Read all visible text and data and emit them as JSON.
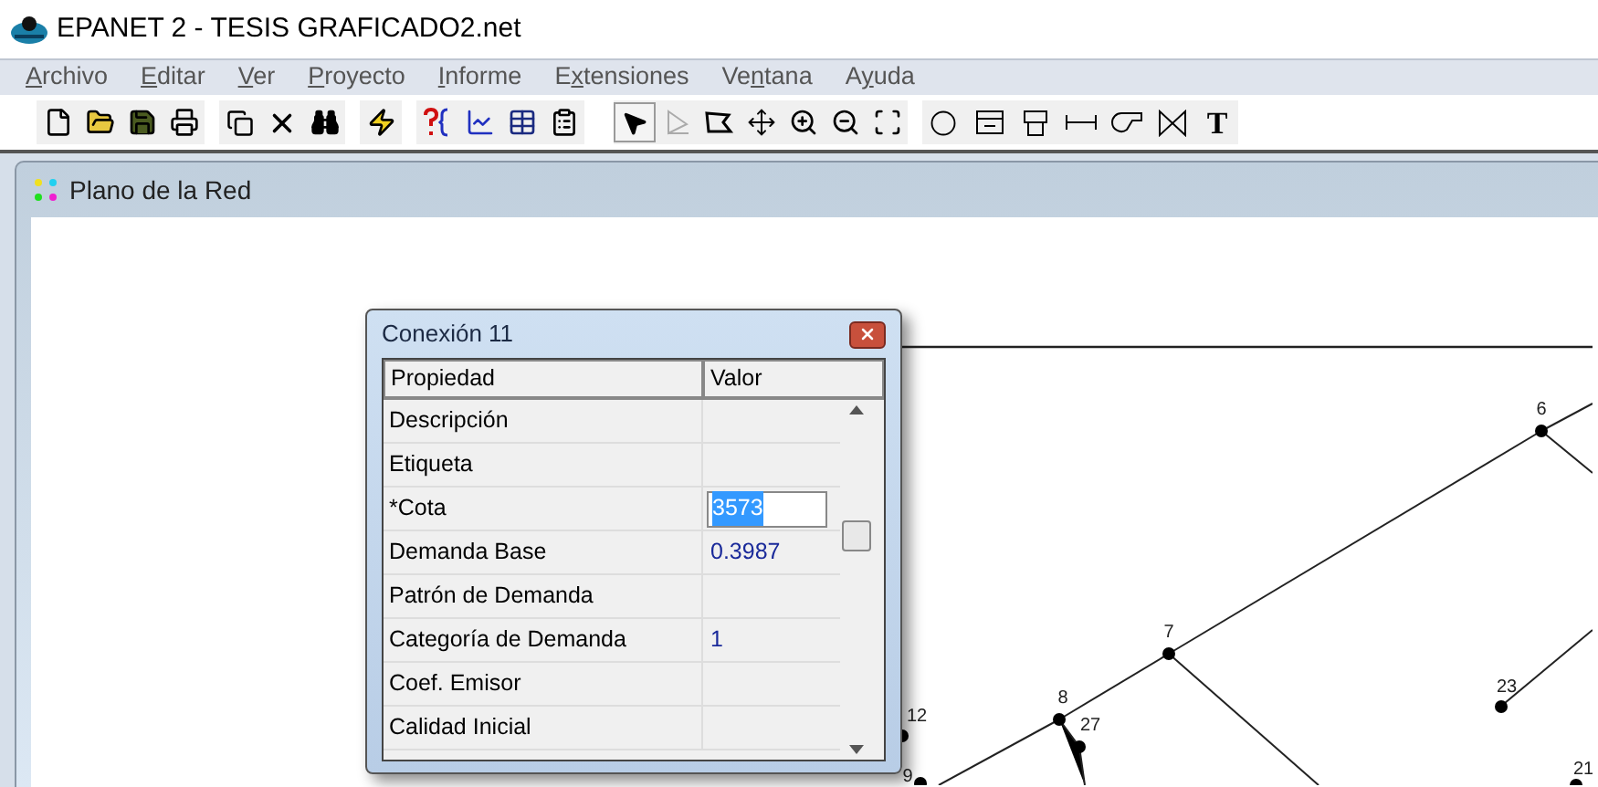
{
  "window": {
    "title": "EPANET 2 - TESIS GRAFICADO2.net"
  },
  "menu": [
    {
      "key": "A",
      "after": "rchivo"
    },
    {
      "key": "E",
      "after": "ditar"
    },
    {
      "key": "V",
      "after": "er"
    },
    {
      "key": "P",
      "after": "royecto"
    },
    {
      "key": "I",
      "after": "nforme"
    },
    {
      "before": "E",
      "key": "x",
      "after": "tensiones"
    },
    {
      "before": "Ve",
      "key": "n",
      "after": "tana"
    },
    {
      "before": "A",
      "key": "y",
      "after": "uda"
    }
  ],
  "map_tools": [
    {
      "kind": "select",
      "selected": true
    },
    {
      "kind": "vertex",
      "selected": false,
      "disabled": true
    },
    {
      "kind": "region",
      "selected": false
    },
    {
      "kind": "pan",
      "selected": false
    },
    {
      "kind": "zoomin",
      "selected": false
    },
    {
      "kind": "zoomout",
      "selected": false
    },
    {
      "kind": "extent",
      "selected": false
    },
    {
      "kind": "junction",
      "selected": false
    },
    {
      "kind": "reservoir",
      "selected": false
    },
    {
      "kind": "tank",
      "selected": false
    },
    {
      "kind": "pipe",
      "selected": false
    },
    {
      "kind": "pump",
      "selected": false
    },
    {
      "kind": "valve",
      "selected": false
    },
    {
      "kind": "label",
      "text": "T",
      "selected": false
    }
  ],
  "map_window": {
    "title": "Plano de la Red"
  },
  "map": {
    "nodes": [
      "6",
      "7",
      "8",
      "27",
      "23",
      "21",
      "12",
      "9"
    ]
  },
  "dialog": {
    "title": "Conexión 11",
    "columns": [
      "Propiedad",
      "Valor"
    ],
    "rows": [
      {
        "property": "Descripción"
      },
      {
        "property": "Etiqueta"
      },
      {
        "property": "*Cota",
        "value": "3573",
        "editing": true
      },
      {
        "property": "Demanda Base",
        "value": "0.3987",
        "editing": false
      },
      {
        "property": "Patrón de Demanda"
      },
      {
        "property": "Categoría de Demanda",
        "value": "1",
        "editing": false
      },
      {
        "property": "Coef. Emisor"
      },
      {
        "property": "Calidad Inicial"
      }
    ]
  }
}
